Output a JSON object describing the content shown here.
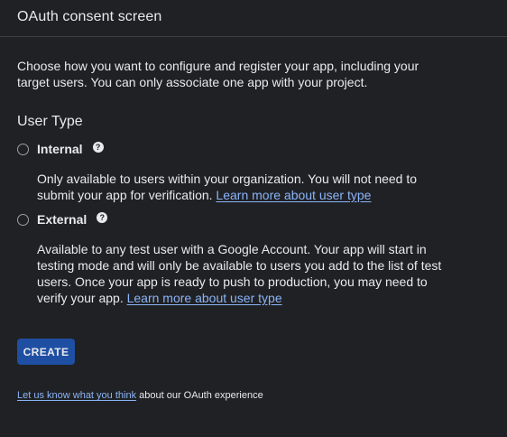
{
  "header": {
    "title": "OAuth consent screen"
  },
  "intro_text": "Choose how you want to configure and register your app, including your target users. You can only associate one app with your project.",
  "user_type": {
    "title": "User Type",
    "help_icon": "question-circle-icon",
    "options": [
      {
        "label": "Internal",
        "description": "Only available to users within your organization. You will not need to submit your app for verification.",
        "link": "Learn more about user type",
        "selected": false
      },
      {
        "label": "External",
        "description": "Available to any test user with a Google Account. Your app will start in testing mode and will only be available to users you add to the list of test users. Once your app is ready to push to production, you may need to verify your app.",
        "link": "Learn more about user type",
        "selected": false
      }
    ]
  },
  "actions": {
    "create_label": "CREATE"
  },
  "feedback": {
    "link": "Let us know what you think",
    "text": " about our OAuth experience"
  },
  "colors": {
    "background": "#202124",
    "text": "#e8eaed",
    "link": "#8ab4f8",
    "button": "#1e4fa3",
    "divider": "#3c4043"
  }
}
